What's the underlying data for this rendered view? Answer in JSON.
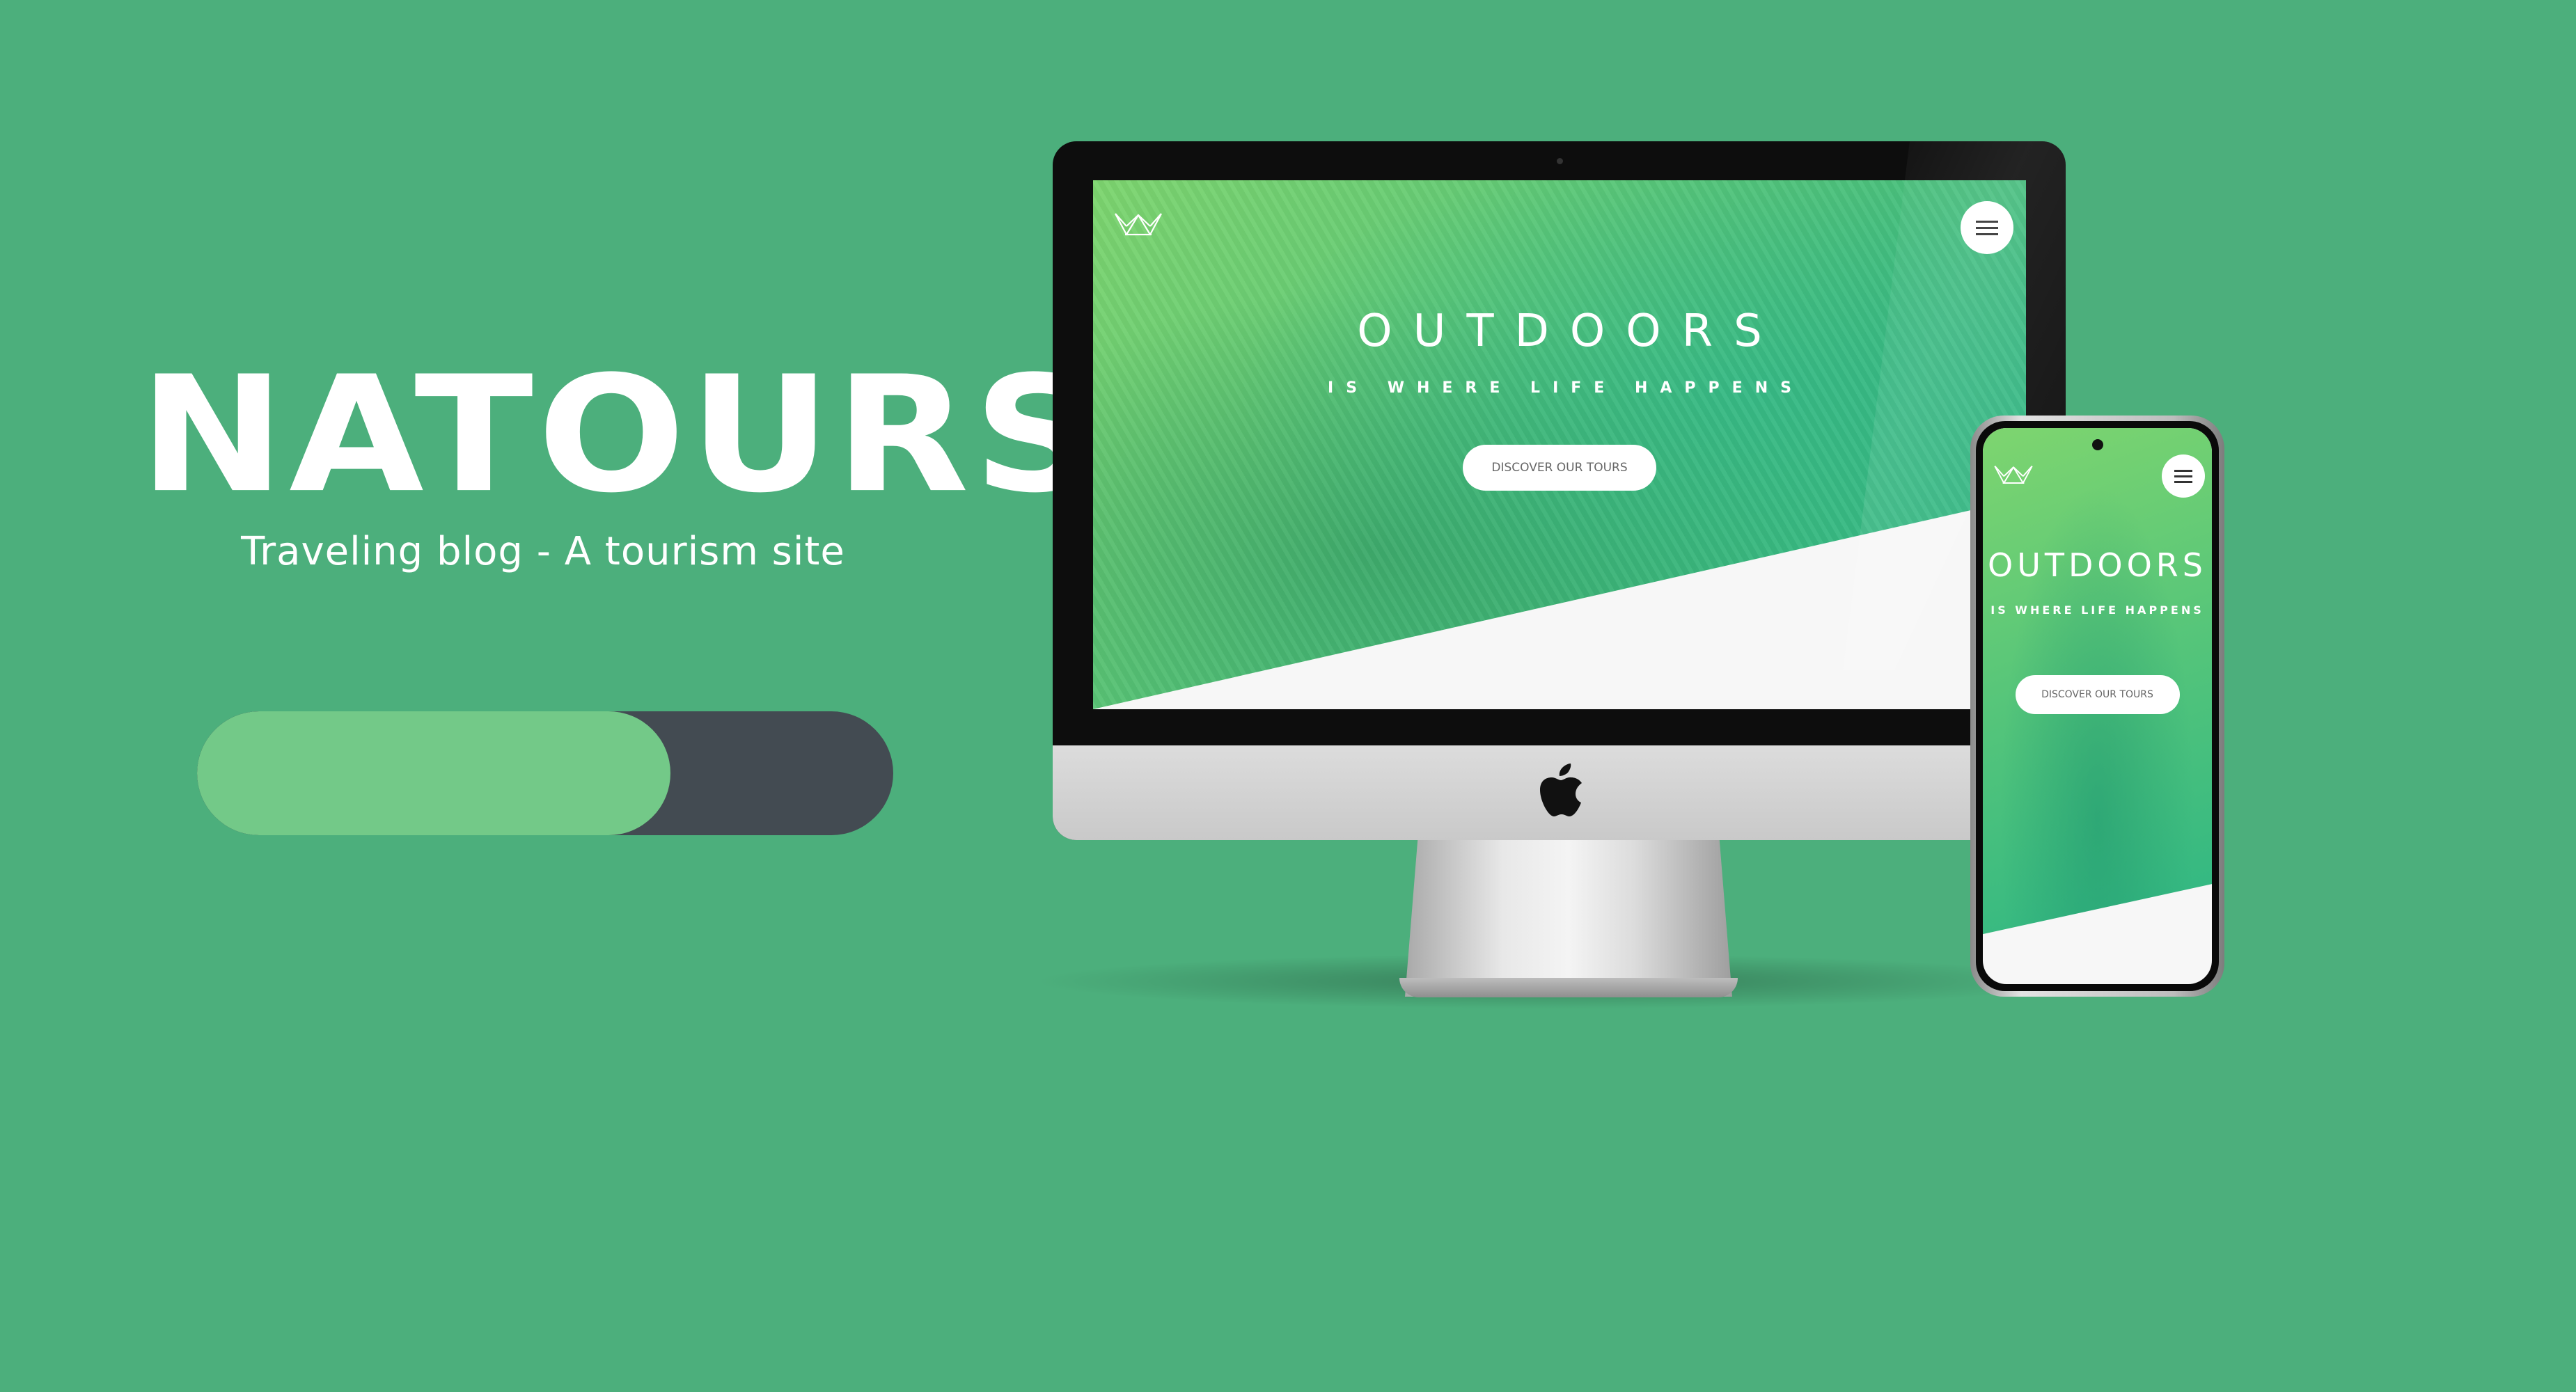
{
  "brand": {
    "title": "NATOURS",
    "tagline": "Traveling blog - A tourism site"
  },
  "progress": {
    "fill_fraction": 0.68,
    "fill_color": "#73c988",
    "track_color": "#434b52"
  },
  "desktop_site": {
    "hero_title": "OUTDOORS",
    "hero_subtitle": "IS WHERE LIFE HAPPENS",
    "cta_label": "DISCOVER OUR TOURS",
    "logo_icon": "crown-outline-icon",
    "menu_icon": "hamburger-menu-icon"
  },
  "mobile_site": {
    "hero_title": "OUTDOORS",
    "hero_subtitle": "IS WHERE LIFE HAPPENS",
    "cta_label": "DISCOVER OUR TOURS",
    "logo_icon": "crown-outline-icon",
    "menu_icon": "hamburger-menu-icon"
  },
  "colors": {
    "background": "#4caf7c",
    "hero_gradient_start": "#7ed56f",
    "hero_gradient_end": "#28b485"
  }
}
